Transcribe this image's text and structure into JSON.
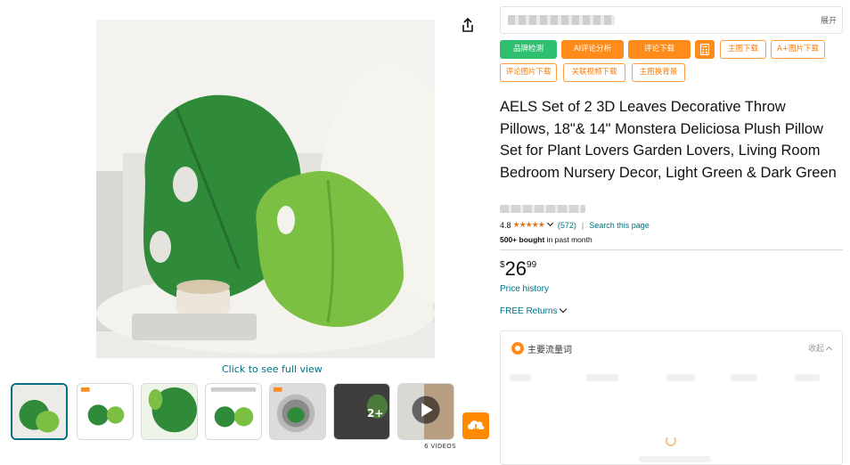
{
  "gallery": {
    "see_full_view": "Click to see full view",
    "more_count": "2+",
    "videos_label": "6 VIDEOS"
  },
  "plugin": {
    "expand_label": "展开",
    "buttons": [
      {
        "label": "品牌检测",
        "style": "green"
      },
      {
        "label": "AI评论分析",
        "style": "orange"
      },
      {
        "label": "评论下载",
        "style": "orange"
      },
      {
        "label": "主图下载",
        "style": "outline"
      },
      {
        "label": "A+图片下载",
        "style": "outline"
      },
      {
        "label": "评论图片下载",
        "style": "outline"
      },
      {
        "label": "关联视频下载",
        "style": "outline"
      },
      {
        "label": "主图换背景",
        "style": "outline"
      }
    ],
    "traffic_panel_title": "主要流量词",
    "collapse_label": "收起"
  },
  "product": {
    "title": "AELS Set of 2 3D Leaves Decorative Throw Pillows, 18\"& 14\" Monstera Deliciosa Plush Pillow Set for Plant Lovers Garden Lovers, Living Room Bedroom Nursery Decor, Light Green & Dark Green",
    "rating": "4.8",
    "stars": "★★★★★",
    "review_count": "(572)",
    "search_page": "Search this page",
    "bought_bold": "500+ bought",
    "bought_rest": " in past month",
    "price_symbol": "$",
    "price_whole": "26",
    "price_fraction": "99",
    "price_history": "Price history",
    "free_returns": "FREE Returns"
  },
  "colors": {
    "link": "#007185",
    "star": "#de7921",
    "plugin_green": "#2fbf71",
    "plugin_orange": "#ff8c1a",
    "leaf_dark": "#2f8a3a",
    "leaf_light": "#7cc043"
  }
}
